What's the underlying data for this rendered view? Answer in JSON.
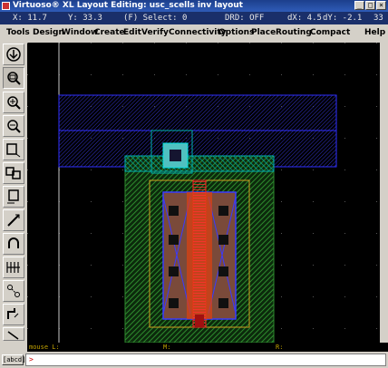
{
  "window": {
    "title": "Virtuoso® XL Layout Editing: usc_scells inv layout",
    "buttons": [
      "_",
      "□",
      "×"
    ]
  },
  "status": {
    "x": "X: 11.7",
    "y": "Y: 33.3",
    "select": "(F) Select: 0",
    "drd": "DRD: OFF",
    "dx": "dX: 4.5",
    "dy": "dY: -2.1",
    "count": "33"
  },
  "menu": [
    "Tools",
    "Design",
    "Window",
    "Create",
    "Edit",
    "Verify",
    "Connectivity",
    "Options",
    "Place",
    "Routing",
    "Compact",
    "Help"
  ],
  "toolbar": {
    "icons": [
      "save-icon",
      "zoom-fit-icon",
      "zoom-in-icon",
      "zoom-out-icon",
      "stretch-icon",
      "copy-icon",
      "move-icon",
      "delete-icon",
      "undo-icon",
      "properties-icon",
      "ruler-icon",
      "path-icon",
      "label-icon"
    ]
  },
  "mouse": {
    "left": "mouse L:",
    "middle": "M:",
    "right": "R:"
  },
  "command": {
    "button": "[abcd]",
    "prompt": ">"
  },
  "colors": {
    "background": "#000000",
    "metal1": "#2222c0",
    "nwell": "#2e8b2e",
    "diffusion": "#00aaaa",
    "poly": "#e02020",
    "contact": "#1a1a3a"
  }
}
